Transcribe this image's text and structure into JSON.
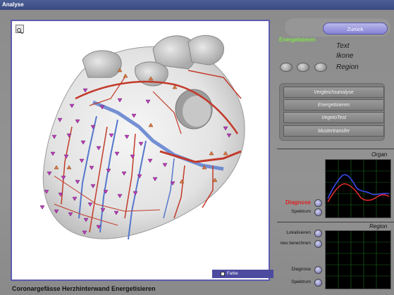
{
  "window": {
    "title": "Analyse"
  },
  "viewer": {
    "caption": "Coronargefässe Herzhinterwand  Energetisieren",
    "farbe_label": "Farbe",
    "farbe_checked": true
  },
  "nav": {
    "back_label": "Zurück"
  },
  "display_options": {
    "title": "Energetisieren",
    "title_color": "#7cff33",
    "options": [
      "Text",
      "Ikone",
      "Region"
    ]
  },
  "menu": {
    "items": [
      "Vergleichsanalyse",
      "Energetisieren",
      "VegetoTest",
      "Mustertransfer"
    ]
  },
  "organ_panel": {
    "title": "Organ",
    "buttons": [
      "Diagnose",
      "Spektrum"
    ],
    "active_color": "#e02020"
  },
  "region_panel": {
    "title": "Region",
    "buttons": [
      "Lokalisieren",
      "neu berechnen",
      "Diagnose",
      "Spektrum"
    ]
  }
}
